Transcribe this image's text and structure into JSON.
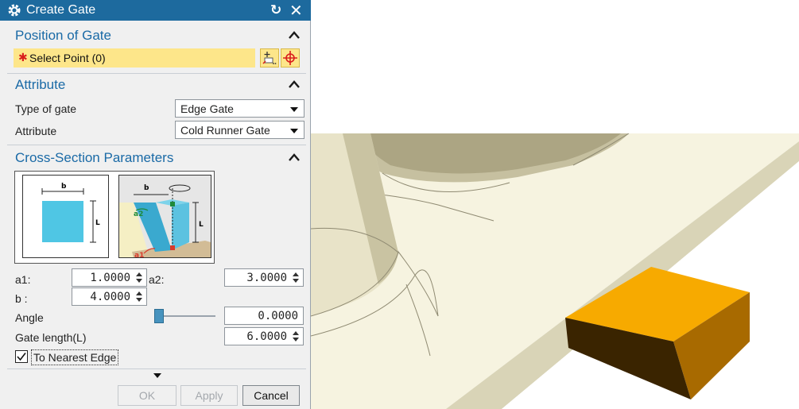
{
  "dialog": {
    "title": "Create Gate",
    "position": {
      "heading": "Position of Gate",
      "select_point": "Select Point (0)",
      "required_marker": "✱"
    },
    "attribute": {
      "heading": "Attribute",
      "type_label": "Type of gate",
      "type_value": "Edge Gate",
      "attr_label": "Attribute",
      "attr_value": "Cold Runner Gate"
    },
    "cross_section": {
      "heading": "Cross-Section Parameters",
      "diagram_labels": {
        "b": "b",
        "L": "L",
        "a1": "a1",
        "a2": "a2"
      },
      "a1_label": "a1:",
      "a1_value": "1.0000",
      "a2_label": "a2:",
      "a2_value": "3.0000",
      "b_label": "b :",
      "b_value": "4.0000",
      "angle_label": "Angle",
      "angle_value": "0.0000",
      "gate_length_label": "Gate length(L)",
      "gate_length_value": "6.0000",
      "nearest_edge_label": "To Nearest Edge",
      "nearest_edge_checked": true
    },
    "buttons": {
      "ok": "OK",
      "apply": "Apply",
      "cancel": "Cancel"
    }
  },
  "colors": {
    "title_bar": "#1d6a9e",
    "section_heading": "#1a6aa6",
    "select_highlight": "#fde68a",
    "gate_block": "#f5a000"
  }
}
